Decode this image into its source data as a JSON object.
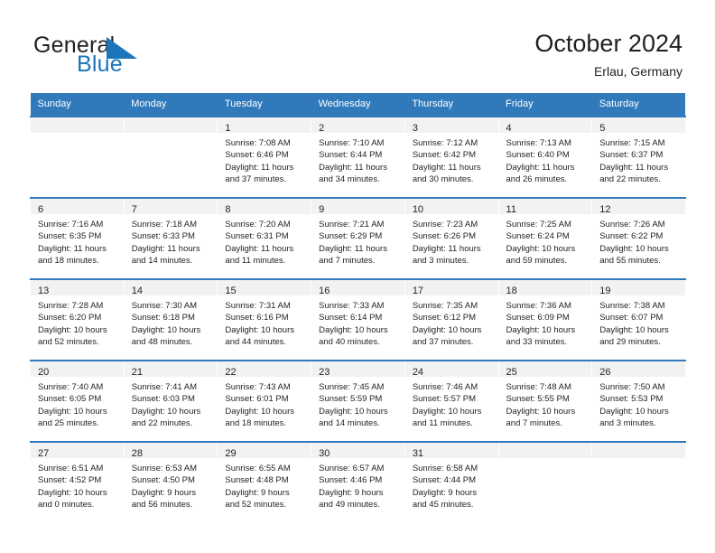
{
  "brand": {
    "name_part1": "General",
    "name_part2": "Blue",
    "accent_color": "#1b75bb",
    "triangle_color": "#1b75bb"
  },
  "header": {
    "title": "October 2024",
    "subtitle": "Erlau, Germany"
  },
  "theme": {
    "header_row_color": "#3079ba",
    "week_border_color": "#3079ba",
    "daynum_band_color": "#f2f2f2",
    "text_color": "#231f20"
  },
  "weekday_headers": [
    "Sunday",
    "Monday",
    "Tuesday",
    "Wednesday",
    "Thursday",
    "Friday",
    "Saturday"
  ],
  "labels": {
    "sunrise_prefix": "Sunrise:",
    "sunset_prefix": "Sunset:",
    "daylight_prefix": "Daylight:"
  },
  "weeks": [
    [
      {
        "day": "",
        "empty": true
      },
      {
        "day": "",
        "empty": true
      },
      {
        "day": "1",
        "sunrise": "Sunrise: 7:08 AM",
        "sunset": "Sunset: 6:46 PM",
        "daylight_line1": "Daylight: 11 hours",
        "daylight_line2": "and 37 minutes."
      },
      {
        "day": "2",
        "sunrise": "Sunrise: 7:10 AM",
        "sunset": "Sunset: 6:44 PM",
        "daylight_line1": "Daylight: 11 hours",
        "daylight_line2": "and 34 minutes."
      },
      {
        "day": "3",
        "sunrise": "Sunrise: 7:12 AM",
        "sunset": "Sunset: 6:42 PM",
        "daylight_line1": "Daylight: 11 hours",
        "daylight_line2": "and 30 minutes."
      },
      {
        "day": "4",
        "sunrise": "Sunrise: 7:13 AM",
        "sunset": "Sunset: 6:40 PM",
        "daylight_line1": "Daylight: 11 hours",
        "daylight_line2": "and 26 minutes."
      },
      {
        "day": "5",
        "sunrise": "Sunrise: 7:15 AM",
        "sunset": "Sunset: 6:37 PM",
        "daylight_line1": "Daylight: 11 hours",
        "daylight_line2": "and 22 minutes."
      }
    ],
    [
      {
        "day": "6",
        "sunrise": "Sunrise: 7:16 AM",
        "sunset": "Sunset: 6:35 PM",
        "daylight_line1": "Daylight: 11 hours",
        "daylight_line2": "and 18 minutes."
      },
      {
        "day": "7",
        "sunrise": "Sunrise: 7:18 AM",
        "sunset": "Sunset: 6:33 PM",
        "daylight_line1": "Daylight: 11 hours",
        "daylight_line2": "and 14 minutes."
      },
      {
        "day": "8",
        "sunrise": "Sunrise: 7:20 AM",
        "sunset": "Sunset: 6:31 PM",
        "daylight_line1": "Daylight: 11 hours",
        "daylight_line2": "and 11 minutes."
      },
      {
        "day": "9",
        "sunrise": "Sunrise: 7:21 AM",
        "sunset": "Sunset: 6:29 PM",
        "daylight_line1": "Daylight: 11 hours",
        "daylight_line2": "and 7 minutes."
      },
      {
        "day": "10",
        "sunrise": "Sunrise: 7:23 AM",
        "sunset": "Sunset: 6:26 PM",
        "daylight_line1": "Daylight: 11 hours",
        "daylight_line2": "and 3 minutes."
      },
      {
        "day": "11",
        "sunrise": "Sunrise: 7:25 AM",
        "sunset": "Sunset: 6:24 PM",
        "daylight_line1": "Daylight: 10 hours",
        "daylight_line2": "and 59 minutes."
      },
      {
        "day": "12",
        "sunrise": "Sunrise: 7:26 AM",
        "sunset": "Sunset: 6:22 PM",
        "daylight_line1": "Daylight: 10 hours",
        "daylight_line2": "and 55 minutes."
      }
    ],
    [
      {
        "day": "13",
        "sunrise": "Sunrise: 7:28 AM",
        "sunset": "Sunset: 6:20 PM",
        "daylight_line1": "Daylight: 10 hours",
        "daylight_line2": "and 52 minutes."
      },
      {
        "day": "14",
        "sunrise": "Sunrise: 7:30 AM",
        "sunset": "Sunset: 6:18 PM",
        "daylight_line1": "Daylight: 10 hours",
        "daylight_line2": "and 48 minutes."
      },
      {
        "day": "15",
        "sunrise": "Sunrise: 7:31 AM",
        "sunset": "Sunset: 6:16 PM",
        "daylight_line1": "Daylight: 10 hours",
        "daylight_line2": "and 44 minutes."
      },
      {
        "day": "16",
        "sunrise": "Sunrise: 7:33 AM",
        "sunset": "Sunset: 6:14 PM",
        "daylight_line1": "Daylight: 10 hours",
        "daylight_line2": "and 40 minutes."
      },
      {
        "day": "17",
        "sunrise": "Sunrise: 7:35 AM",
        "sunset": "Sunset: 6:12 PM",
        "daylight_line1": "Daylight: 10 hours",
        "daylight_line2": "and 37 minutes."
      },
      {
        "day": "18",
        "sunrise": "Sunrise: 7:36 AM",
        "sunset": "Sunset: 6:09 PM",
        "daylight_line1": "Daylight: 10 hours",
        "daylight_line2": "and 33 minutes."
      },
      {
        "day": "19",
        "sunrise": "Sunrise: 7:38 AM",
        "sunset": "Sunset: 6:07 PM",
        "daylight_line1": "Daylight: 10 hours",
        "daylight_line2": "and 29 minutes."
      }
    ],
    [
      {
        "day": "20",
        "sunrise": "Sunrise: 7:40 AM",
        "sunset": "Sunset: 6:05 PM",
        "daylight_line1": "Daylight: 10 hours",
        "daylight_line2": "and 25 minutes."
      },
      {
        "day": "21",
        "sunrise": "Sunrise: 7:41 AM",
        "sunset": "Sunset: 6:03 PM",
        "daylight_line1": "Daylight: 10 hours",
        "daylight_line2": "and 22 minutes."
      },
      {
        "day": "22",
        "sunrise": "Sunrise: 7:43 AM",
        "sunset": "Sunset: 6:01 PM",
        "daylight_line1": "Daylight: 10 hours",
        "daylight_line2": "and 18 minutes."
      },
      {
        "day": "23",
        "sunrise": "Sunrise: 7:45 AM",
        "sunset": "Sunset: 5:59 PM",
        "daylight_line1": "Daylight: 10 hours",
        "daylight_line2": "and 14 minutes."
      },
      {
        "day": "24",
        "sunrise": "Sunrise: 7:46 AM",
        "sunset": "Sunset: 5:57 PM",
        "daylight_line1": "Daylight: 10 hours",
        "daylight_line2": "and 11 minutes."
      },
      {
        "day": "25",
        "sunrise": "Sunrise: 7:48 AM",
        "sunset": "Sunset: 5:55 PM",
        "daylight_line1": "Daylight: 10 hours",
        "daylight_line2": "and 7 minutes."
      },
      {
        "day": "26",
        "sunrise": "Sunrise: 7:50 AM",
        "sunset": "Sunset: 5:53 PM",
        "daylight_line1": "Daylight: 10 hours",
        "daylight_line2": "and 3 minutes."
      }
    ],
    [
      {
        "day": "27",
        "sunrise": "Sunrise: 6:51 AM",
        "sunset": "Sunset: 4:52 PM",
        "daylight_line1": "Daylight: 10 hours",
        "daylight_line2": "and 0 minutes."
      },
      {
        "day": "28",
        "sunrise": "Sunrise: 6:53 AM",
        "sunset": "Sunset: 4:50 PM",
        "daylight_line1": "Daylight: 9 hours",
        "daylight_line2": "and 56 minutes."
      },
      {
        "day": "29",
        "sunrise": "Sunrise: 6:55 AM",
        "sunset": "Sunset: 4:48 PM",
        "daylight_line1": "Daylight: 9 hours",
        "daylight_line2": "and 52 minutes."
      },
      {
        "day": "30",
        "sunrise": "Sunrise: 6:57 AM",
        "sunset": "Sunset: 4:46 PM",
        "daylight_line1": "Daylight: 9 hours",
        "daylight_line2": "and 49 minutes."
      },
      {
        "day": "31",
        "sunrise": "Sunrise: 6:58 AM",
        "sunset": "Sunset: 4:44 PM",
        "daylight_line1": "Daylight: 9 hours",
        "daylight_line2": "and 45 minutes."
      },
      {
        "day": "",
        "empty": true
      },
      {
        "day": "",
        "empty": true
      }
    ]
  ]
}
